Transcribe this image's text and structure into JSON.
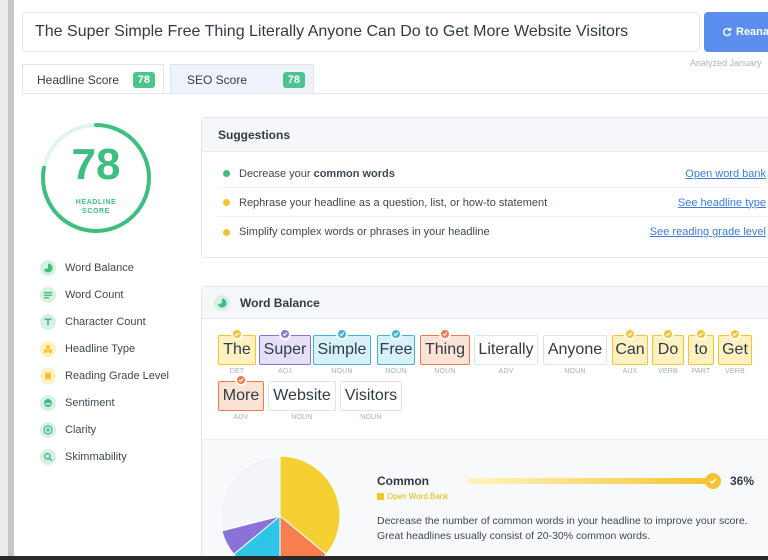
{
  "header": {
    "headline_text": "The Super Simple Free Thing Literally Anyone Can Do to Get More Website Visitors",
    "reanalyze_label": "Reana",
    "analyzed_text": "Analyzed January"
  },
  "tabs": [
    {
      "label": "Headline Score",
      "score": "78",
      "active": true
    },
    {
      "label": "SEO Score",
      "score": "78",
      "active": false
    }
  ],
  "score": {
    "value": "78",
    "fraction": 0.78,
    "label_line1": "HEADLINE",
    "label_line2": "SCORE",
    "color": "#3fbf7f"
  },
  "sidebar": {
    "items": [
      {
        "label": "Word Balance",
        "icon": "pie-chart-icon"
      },
      {
        "label": "Word Count",
        "icon": "lines-icon"
      },
      {
        "label": "Character Count",
        "icon": "letter-t-icon"
      },
      {
        "label": "Headline Type",
        "icon": "shapes-icon"
      },
      {
        "label": "Reading Grade Level",
        "icon": "book-icon"
      },
      {
        "label": "Sentiment",
        "icon": "face-icon"
      },
      {
        "label": "Clarity",
        "icon": "target-icon"
      },
      {
        "label": "Skimmability",
        "icon": "magnifier-icon"
      }
    ]
  },
  "suggestions": {
    "title": "Suggestions",
    "items": [
      {
        "prefix": "Decrease your ",
        "strong": "common words",
        "suffix": "",
        "link": "Open word bank",
        "dot_color": "#3fbf7f"
      },
      {
        "prefix": "Rephrase your headline as a question, list, or how-to statement",
        "strong": "",
        "suffix": "",
        "link": "See headline type",
        "dot_color": "#f4c430"
      },
      {
        "prefix": "Simplify complex words or phrases in your headline",
        "strong": "",
        "suffix": "",
        "link": "See reading grade level",
        "dot_color": "#f4c430"
      }
    ]
  },
  "word_balance": {
    "title": "Word Balance",
    "words": [
      {
        "text": "The",
        "pos": "DET",
        "type": "common"
      },
      {
        "text": "Super",
        "pos": "ADJ",
        "type": "power"
      },
      {
        "text": "Simple",
        "pos": "NOUN",
        "type": "emotional"
      },
      {
        "text": "Free",
        "pos": "NOUN",
        "type": "emotional"
      },
      {
        "text": "Thing",
        "pos": "NOUN",
        "type": "uncommon"
      },
      {
        "text": "Literally",
        "pos": "ADV",
        "type": "none"
      },
      {
        "text": "Anyone",
        "pos": "NOUN",
        "type": "none"
      },
      {
        "text": "Can",
        "pos": "AUX",
        "type": "common"
      },
      {
        "text": "Do",
        "pos": "VERB",
        "type": "common"
      },
      {
        "text": "to",
        "pos": "PART",
        "type": "common"
      },
      {
        "text": "Get",
        "pos": "VERB",
        "type": "common"
      },
      {
        "text": "More",
        "pos": "ADV",
        "type": "uncommon"
      },
      {
        "text": "Website",
        "pos": "NOUN",
        "type": "none"
      },
      {
        "text": "Visitors",
        "pos": "NOUN",
        "type": "none"
      }
    ],
    "colors": {
      "common": {
        "bg": "#fdf1c2",
        "border": "#f4c430"
      },
      "power": {
        "bg": "#e5e0f8",
        "border": "#8a72d8"
      },
      "emotional": {
        "bg": "#d7f1f9",
        "border": "#3fb3d8"
      },
      "uncommon": {
        "bg": "#fde2d6",
        "border": "#f07a4c"
      },
      "none": {
        "bg": "#ffffff",
        "border": "#dfe3e7"
      }
    },
    "pie": [
      {
        "label": "common",
        "fraction": 0.36,
        "color": "#f4d033"
      },
      {
        "label": "uncommon",
        "fraction": 0.14,
        "color": "#f77e4e"
      },
      {
        "label": "emotional",
        "fraction": 0.14,
        "color": "#2ec5e6"
      },
      {
        "label": "power",
        "fraction": 0.07,
        "color": "#8a72d8"
      },
      {
        "label": "other",
        "fraction": 0.29,
        "color": "#f4f5fb"
      }
    ],
    "common": {
      "title": "Common",
      "link": "Open Word Bank",
      "percent_label": "36%",
      "fraction": 0.36,
      "description": "Decrease the number of common words in your headline to improve your score. Great headlines usually consist of 20-30% common words."
    }
  }
}
